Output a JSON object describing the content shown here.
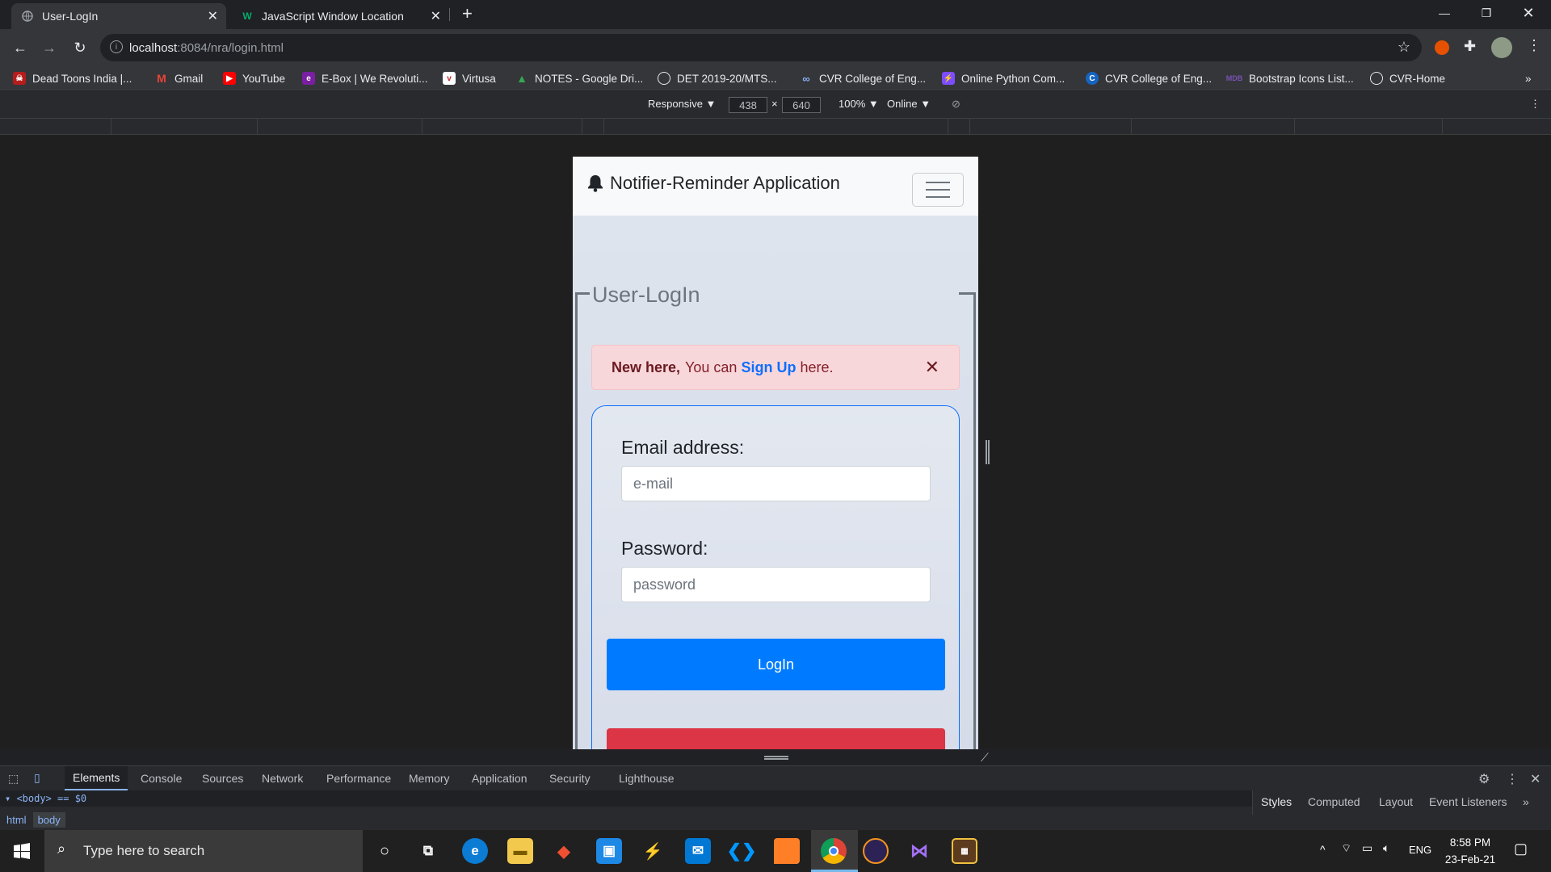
{
  "browser": {
    "tabs": [
      {
        "label": "User-LogIn",
        "active": true
      },
      {
        "label": "JavaScript Window Location",
        "active": false
      }
    ],
    "url_host": "localhost",
    "url_path": ":8084/nra/login.html"
  },
  "bookmarks": [
    {
      "label": "Dead Toons India |...",
      "color": "#b71c1c",
      "icon": "dead-toons-icon"
    },
    {
      "label": "Gmail",
      "color": "#ea4335",
      "icon": "gmail-icon"
    },
    {
      "label": "YouTube",
      "color": "#ff0000",
      "icon": "youtube-icon"
    },
    {
      "label": "E-Box | We Revoluti...",
      "color": "#7b1fa2",
      "icon": "ebox-icon"
    },
    {
      "label": "Virtusa",
      "color": "#ffffff",
      "icon": "virtusa-icon"
    },
    {
      "label": "NOTES - Google Dri...",
      "color": "#34a853",
      "icon": "google-drive-icon"
    },
    {
      "label": "DET 2019-20/MTS...",
      "color": "#9aa0a6",
      "icon": "globe-icon"
    },
    {
      "label": "CVR College of Eng...",
      "color": "#8ab4f8",
      "icon": "link-icon"
    },
    {
      "label": "Online Python Com...",
      "color": "#7c4dff",
      "icon": "python-compiler-icon"
    },
    {
      "label": "CVR College of Eng...",
      "color": "#1565c0",
      "icon": "cvr-icon"
    },
    {
      "label": "Bootstrap Icons List...",
      "color": "#7952b3",
      "icon": "mdb-icon"
    },
    {
      "label": "CVR-Home",
      "color": "#9aa0a6",
      "icon": "globe-icon"
    }
  ],
  "device_toolbar": {
    "mode": "Responsive ▼",
    "width": "438",
    "height": "640",
    "zoom": "100% ▼",
    "network": "Online ▼"
  },
  "app": {
    "brand": "Notifier-Reminder Application",
    "legend": "User-LogIn",
    "alert": {
      "bold": "New here,",
      "pre": "You can",
      "link": "Sign Up",
      "post": "here."
    },
    "email_label": "Email address:",
    "email_placeholder": "e-mail",
    "password_label": "Password:",
    "password_placeholder": "password",
    "login_button": "LogIn"
  },
  "devtools": {
    "tabs": [
      "Elements",
      "Console",
      "Sources",
      "Network",
      "Performance",
      "Memory",
      "Application",
      "Security",
      "Lighthouse"
    ],
    "active_tab": "Elements",
    "dom_line": "▾ <body> == $0",
    "breadcrumb": [
      "html",
      "body"
    ],
    "side_tabs": [
      "Styles",
      "Computed",
      "Layout",
      "Event Listeners"
    ]
  },
  "taskbar": {
    "search_placeholder": "Type here to search",
    "lang": "ENG",
    "time": "8:58 PM",
    "date": "23-Feb-21"
  }
}
